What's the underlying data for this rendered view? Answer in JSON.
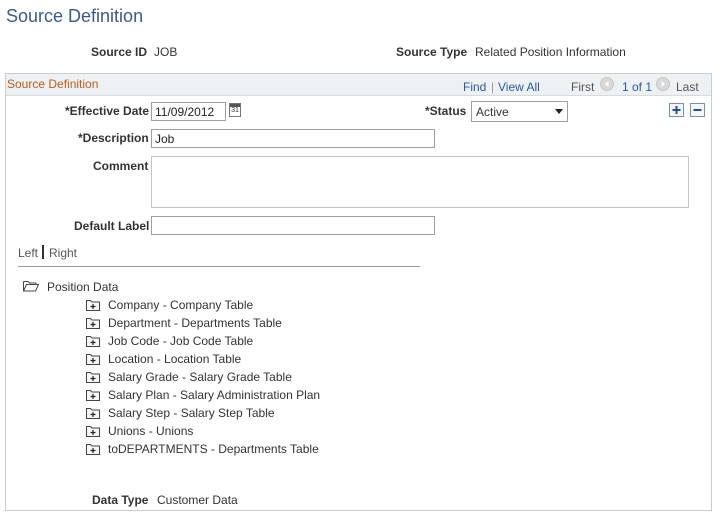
{
  "page": {
    "title": "Source Definition"
  },
  "header": {
    "source_id_label": "Source ID",
    "source_id_value": "JOB",
    "source_type_label": "Source Type",
    "source_type_value": "Related Position Information"
  },
  "section": {
    "title": "Source Definition",
    "find": "Find",
    "divider": "|",
    "view_all": "View All",
    "first": "First",
    "page_count": "1 of 1",
    "last": "Last"
  },
  "form": {
    "effective_date_label": "*Effective Date",
    "effective_date_value": "11/09/2012",
    "calendar_icon_text": "31",
    "status_label": "*Status",
    "status_value": "Active",
    "description_label": "*Description",
    "description_value": "Job",
    "comment_label": "Comment",
    "comment_value": "",
    "default_label_label": "Default Label",
    "default_label_value": ""
  },
  "tabs": {
    "left": "Left",
    "right": "Right"
  },
  "tree": {
    "root": "Position Data",
    "items": [
      "Company - Company Table",
      "Department - Departments Table",
      "Job Code - Job Code Table",
      "Location - Location Table",
      "Salary Grade - Salary Grade Table",
      "Salary Plan - Salary Administration Plan",
      "Salary Step - Salary Step Table",
      "Unions - Unions",
      "toDEPARTMENTS - Departments Table"
    ]
  },
  "footer": {
    "data_type_label": "Data Type",
    "data_type_value": "Customer Data"
  },
  "colors": {
    "title": "#3c5a8a",
    "section_title": "#b95d1a",
    "link": "#2b5a9a"
  },
  "icons": {
    "calendar": "calendar-icon",
    "dropdown": "chevron-down-icon",
    "add": "plus-icon",
    "remove": "minus-icon",
    "first": "arrow-left-icon",
    "last": "arrow-right-icon",
    "root_folder": "open-folder-icon",
    "child_folder": "expand-folder-icon"
  }
}
